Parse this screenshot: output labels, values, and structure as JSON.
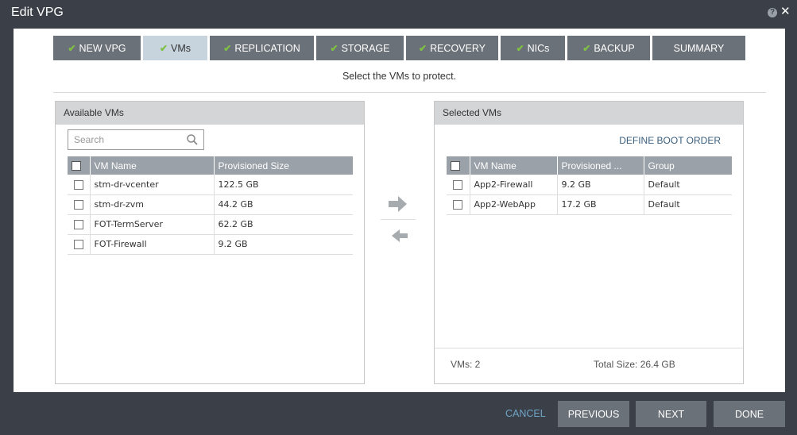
{
  "window": {
    "title": "Edit VPG",
    "help_glyph": "?",
    "close_glyph": "✕"
  },
  "tabs": [
    {
      "label": "NEW VPG",
      "checked": true
    },
    {
      "label": "VMs",
      "checked": true,
      "active": true
    },
    {
      "label": "REPLICATION",
      "checked": true
    },
    {
      "label": "STORAGE",
      "checked": true
    },
    {
      "label": "RECOVERY",
      "checked": true
    },
    {
      "label": "NICs",
      "checked": true
    },
    {
      "label": "BACKUP",
      "checked": true
    },
    {
      "label": "SUMMARY",
      "checked": false
    }
  ],
  "check_glyph": "✔",
  "subtitle": "Select the VMs to protect.",
  "available": {
    "title": "Available VMs",
    "search_placeholder": "Search",
    "columns": [
      "VM Name",
      "Provisioned Size"
    ],
    "rows": [
      {
        "name": "stm-dr-vcenter",
        "size": "122.5 GB"
      },
      {
        "name": "stm-dr-zvm",
        "size": "44.2 GB"
      },
      {
        "name": "FOT-TermServer",
        "size": "62.2 GB"
      },
      {
        "name": "FOT-Firewall",
        "size": "9.2 GB"
      }
    ]
  },
  "selected": {
    "title": "Selected VMs",
    "boot_order_link": "DEFINE BOOT ORDER",
    "columns": [
      "VM Name",
      "Provisioned ...",
      "Group"
    ],
    "rows": [
      {
        "name": "App2-Firewall",
        "size": "9.2 GB",
        "group": "Default"
      },
      {
        "name": "App2-WebApp",
        "size": "17.2 GB",
        "group": "Default"
      }
    ],
    "footer_vms": "VMs: 2",
    "footer_size": "Total Size: 26.4 GB"
  },
  "buttons": {
    "cancel": "CANCEL",
    "previous": "PREVIOUS",
    "next": "NEXT",
    "done": "DONE"
  },
  "colors": {
    "tab_active": "#c7d3dd",
    "tab": "#6b7178",
    "check": "#7fc143",
    "link": "#3a5f7e"
  }
}
